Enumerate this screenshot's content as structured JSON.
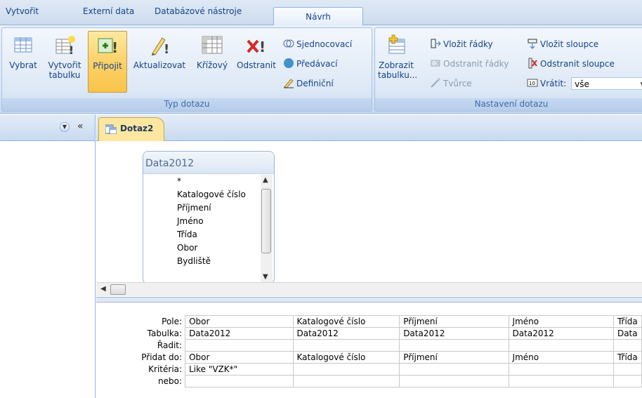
{
  "ribbon_tabs": [
    "Vytvořit",
    "Externí data",
    "Databázové nástroje",
    "Návrh"
  ],
  "group_query_type": {
    "label": "Typ dotazu",
    "buttons": [
      {
        "line1": "Vybrat",
        "line2": ""
      },
      {
        "line1": "Vytvořit",
        "line2": "tabulku"
      },
      {
        "line1": "Připojit",
        "line2": ""
      },
      {
        "line1": "Aktualizovat",
        "line2": ""
      },
      {
        "line1": "Křížový",
        "line2": ""
      },
      {
        "line1": "Odstranit",
        "line2": ""
      }
    ],
    "small": [
      "Sjednocovací",
      "Předávací",
      "Definiční"
    ]
  },
  "group_query_setup": {
    "label": "Nastavení dotazu",
    "show_table": {
      "line1": "Zobrazit",
      "line2": "tabulku..."
    },
    "small": [
      "Vložit řádky",
      "Odstranit řádky",
      "Tvůrce",
      "Vložit sloupce",
      "Odstranit sloupce",
      "Vrátit:"
    ],
    "return_value": "vše"
  },
  "nav": {
    "collapse": "«"
  },
  "doc_tab": "Dotaz2",
  "field_list": {
    "title": "Data2012",
    "fields": [
      "*",
      "Katalogové číslo",
      "Příjmení",
      "Jméno",
      "Třída",
      "Obor",
      "Bydliště"
    ]
  },
  "grid": {
    "row_headers": [
      "Pole:",
      "Tabulka:",
      "Řadit:",
      "Přidat do:",
      "Kritéria:",
      "nebo:"
    ],
    "columns": [
      {
        "cells": [
          "Obor",
          "Data2012",
          "",
          "Obor",
          "Like \"VZK*\"",
          ""
        ]
      },
      {
        "cells": [
          "Katalogové číslo",
          "Data2012",
          "",
          "Katalogové číslo",
          "",
          ""
        ]
      },
      {
        "cells": [
          "Příjmení",
          "Data2012",
          "",
          "Příjmení",
          "",
          ""
        ]
      },
      {
        "cells": [
          "Jméno",
          "Data2012",
          "",
          "Jméno",
          "",
          ""
        ]
      },
      {
        "cells": [
          "Třída",
          "Data",
          "",
          "Třída",
          "",
          ""
        ]
      }
    ]
  }
}
